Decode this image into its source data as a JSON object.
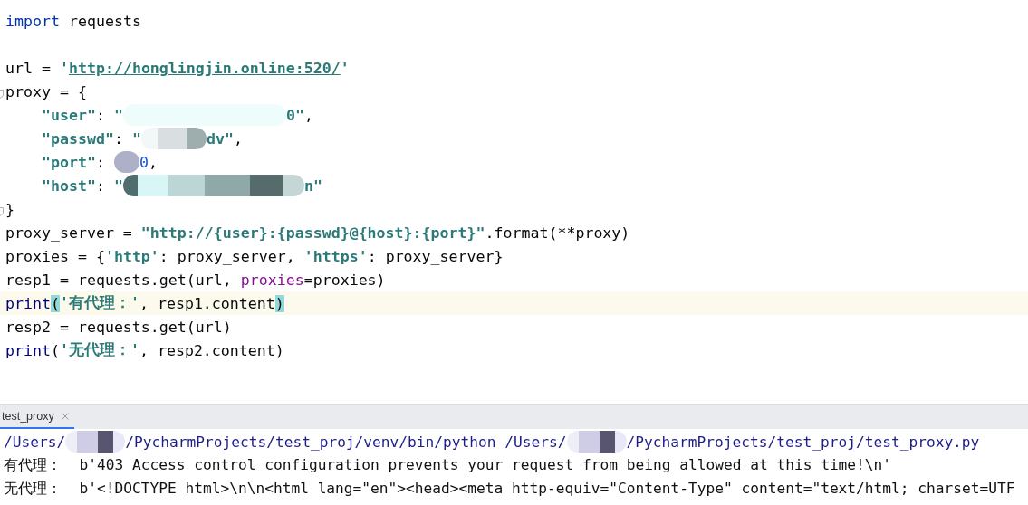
{
  "editor": {
    "lines": [
      {
        "tokens": [
          {
            "kind": "keyword",
            "text": "import"
          },
          {
            "kind": "plain",
            "text": " requests"
          }
        ]
      },
      {
        "kind": "blank"
      },
      {
        "tokens": [
          {
            "kind": "plain",
            "text": "url = "
          },
          {
            "kind": "string",
            "text": "'"
          },
          {
            "kind": "url",
            "text": "http://honglingjin.online:520/"
          },
          {
            "kind": "string",
            "text": "'"
          }
        ]
      },
      {
        "fold": true,
        "tokens": [
          {
            "kind": "plain",
            "text": "proxy = {"
          }
        ]
      },
      {
        "indented": true,
        "tokens": [
          {
            "kind": "string",
            "text": "\"user\""
          },
          {
            "kind": "plain",
            "text": ": "
          },
          {
            "kind": "string",
            "text": "\""
          },
          {
            "kind": "smudge"
          },
          {
            "kind": "string",
            "text": "0\""
          },
          {
            "kind": "plain",
            "text": ","
          }
        ]
      },
      {
        "indented": true,
        "tokens": [
          {
            "kind": "string",
            "text": "\"passwd\""
          },
          {
            "kind": "plain",
            "text": ": "
          },
          {
            "kind": "string",
            "text": "\""
          },
          {
            "kind": "blot"
          },
          {
            "kind": "string",
            "text": "dv\""
          },
          {
            "kind": "plain",
            "text": ","
          }
        ]
      },
      {
        "indented": true,
        "tokens": [
          {
            "kind": "string",
            "text": "\"port\""
          },
          {
            "kind": "plain",
            "text": ": "
          },
          {
            "kind": "dot"
          },
          {
            "kind": "number",
            "text": "0"
          },
          {
            "kind": "plain",
            "text": ","
          }
        ]
      },
      {
        "indented": true,
        "tokens": [
          {
            "kind": "string",
            "text": "\"host\""
          },
          {
            "kind": "plain",
            "text": ": "
          },
          {
            "kind": "string",
            "text": "\""
          },
          {
            "kind": "streak"
          },
          {
            "kind": "string",
            "text": "n\""
          }
        ]
      },
      {
        "fold": true,
        "tokens": [
          {
            "kind": "plain",
            "text": "}"
          }
        ]
      },
      {
        "tokens": [
          {
            "kind": "plain",
            "text": "proxy_server = "
          },
          {
            "kind": "string",
            "text": "\"http://{user}:{passwd}@{host}:{port}\""
          },
          {
            "kind": "plain",
            "text": ".format(**proxy)"
          }
        ]
      },
      {
        "tokens": [
          {
            "kind": "plain",
            "text": "proxies = {"
          },
          {
            "kind": "string",
            "text": "'http'"
          },
          {
            "kind": "plain",
            "text": ": proxy_server, "
          },
          {
            "kind": "string",
            "text": "'https'"
          },
          {
            "kind": "plain",
            "text": ": proxy_server}"
          }
        ]
      },
      {
        "tokens": [
          {
            "kind": "plain",
            "text": "resp1 = requests.get(url, "
          },
          {
            "kind": "kwarg",
            "text": "proxies"
          },
          {
            "kind": "plain",
            "text": "=proxies)"
          }
        ]
      },
      {
        "current": true,
        "tokens": [
          {
            "kind": "builtin",
            "text": "print"
          },
          {
            "kind": "bracket",
            "text": "("
          },
          {
            "kind": "string",
            "text": "'有代理：'"
          },
          {
            "kind": "plain",
            "text": ", resp1.content"
          },
          {
            "kind": "bracket",
            "text": ")"
          }
        ]
      },
      {
        "tokens": [
          {
            "kind": "plain",
            "text": "resp2 = requests.get(url)"
          }
        ]
      },
      {
        "tokens": [
          {
            "kind": "builtin",
            "text": "print"
          },
          {
            "kind": "plain",
            "text": "("
          },
          {
            "kind": "string",
            "text": "'无代理：'"
          },
          {
            "kind": "plain",
            "text": ", resp2.content)"
          }
        ]
      }
    ]
  },
  "run_panel": {
    "tabs": [
      {
        "label": "test_proxy",
        "selected": true
      }
    ],
    "lines": [
      {
        "tokens": [
          {
            "kind": "path",
            "text": "/Users/"
          },
          {
            "kind": "patch"
          },
          {
            "kind": "path",
            "text": "/PycharmProjects/test_proj/venv/bin/python /Users/"
          },
          {
            "kind": "patch"
          },
          {
            "kind": "path",
            "text": "/PycharmProjects/test_proj/test_proxy.py"
          }
        ]
      },
      {
        "tokens": [
          {
            "kind": "output",
            "text": "有代理：  b'403 Access control configuration prevents your request from being allowed at this time!\\n'"
          }
        ]
      },
      {
        "tokens": [
          {
            "kind": "output",
            "text": "无代理：  b'<!DOCTYPE html>\\n\\n<html lang=\"en\"><head><meta http-equiv=\"Content-Type\" content=\"text/html; charset=UTF"
          }
        ]
      }
    ]
  }
}
